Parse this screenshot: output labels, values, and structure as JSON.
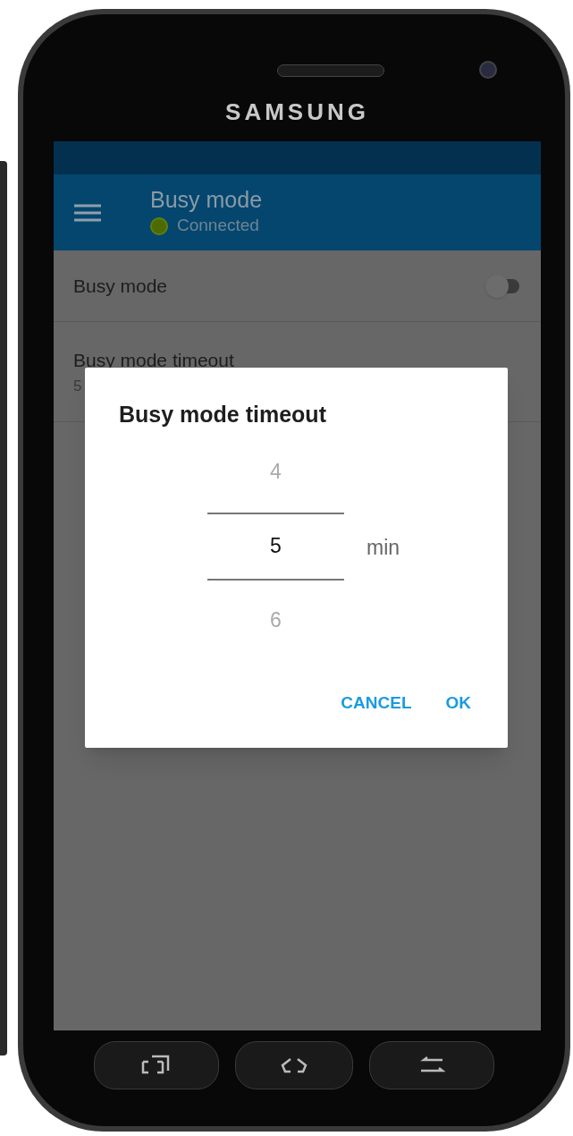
{
  "device": {
    "brand": "SAMSUNG"
  },
  "app_bar": {
    "title": "Busy mode",
    "status": "Connected",
    "connected": true
  },
  "settings": [
    {
      "kind": "switch",
      "title": "Busy mode",
      "on": false
    },
    {
      "kind": "value",
      "title": "Busy mode timeout",
      "value": "5"
    }
  ],
  "dialog": {
    "title": "Busy mode timeout",
    "picker": [
      {
        "value": "4",
        "selected": false
      },
      {
        "value": "5",
        "selected": true
      },
      {
        "value": "6",
        "selected": false
      }
    ],
    "unit": "min",
    "buttons": [
      "CANCEL",
      "OK"
    ]
  }
}
